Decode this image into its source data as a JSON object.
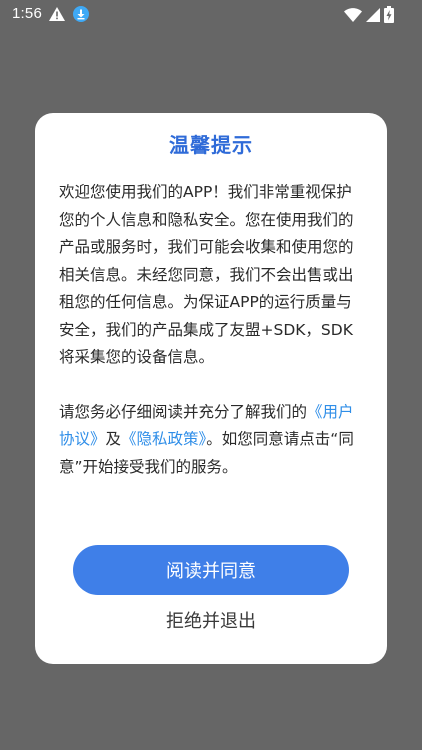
{
  "status_bar": {
    "time": "1:56",
    "left_icons": [
      "alert-icon",
      "download-icon"
    ],
    "right_icons": [
      "wifi-icon",
      "signal-icon",
      "battery-charging-icon"
    ]
  },
  "dialog": {
    "title": "温馨提示",
    "paragraph_1": "欢迎您使用我们的APP！我们非常重视保护您的个人信息和隐私安全。您在使用我们的产品或服务时，我们可能会收集和使用您的相关信息。未经您同意，我们不会出售或出租您的任何信息。为保证APP的运行质量与安全，我们的产品集成了友盟+SDK，SDK将采集您的设备信息。",
    "paragraph_2_prefix": "请您务必仔细阅读并充分了解我们的",
    "user_agreement_link": "《用户协议》",
    "and_text": "及",
    "privacy_policy_link": "《隐私政策》",
    "paragraph_2_suffix": "。如您同意请点击“同意”开始接受我们的服务。",
    "agree_button": "阅读并同意",
    "reject_button": "拒绝并退出"
  },
  "colors": {
    "overlay": "#666666",
    "title": "#2f6bd8",
    "link": "#2f8ee8",
    "primary_button": "#3f7fe8"
  }
}
